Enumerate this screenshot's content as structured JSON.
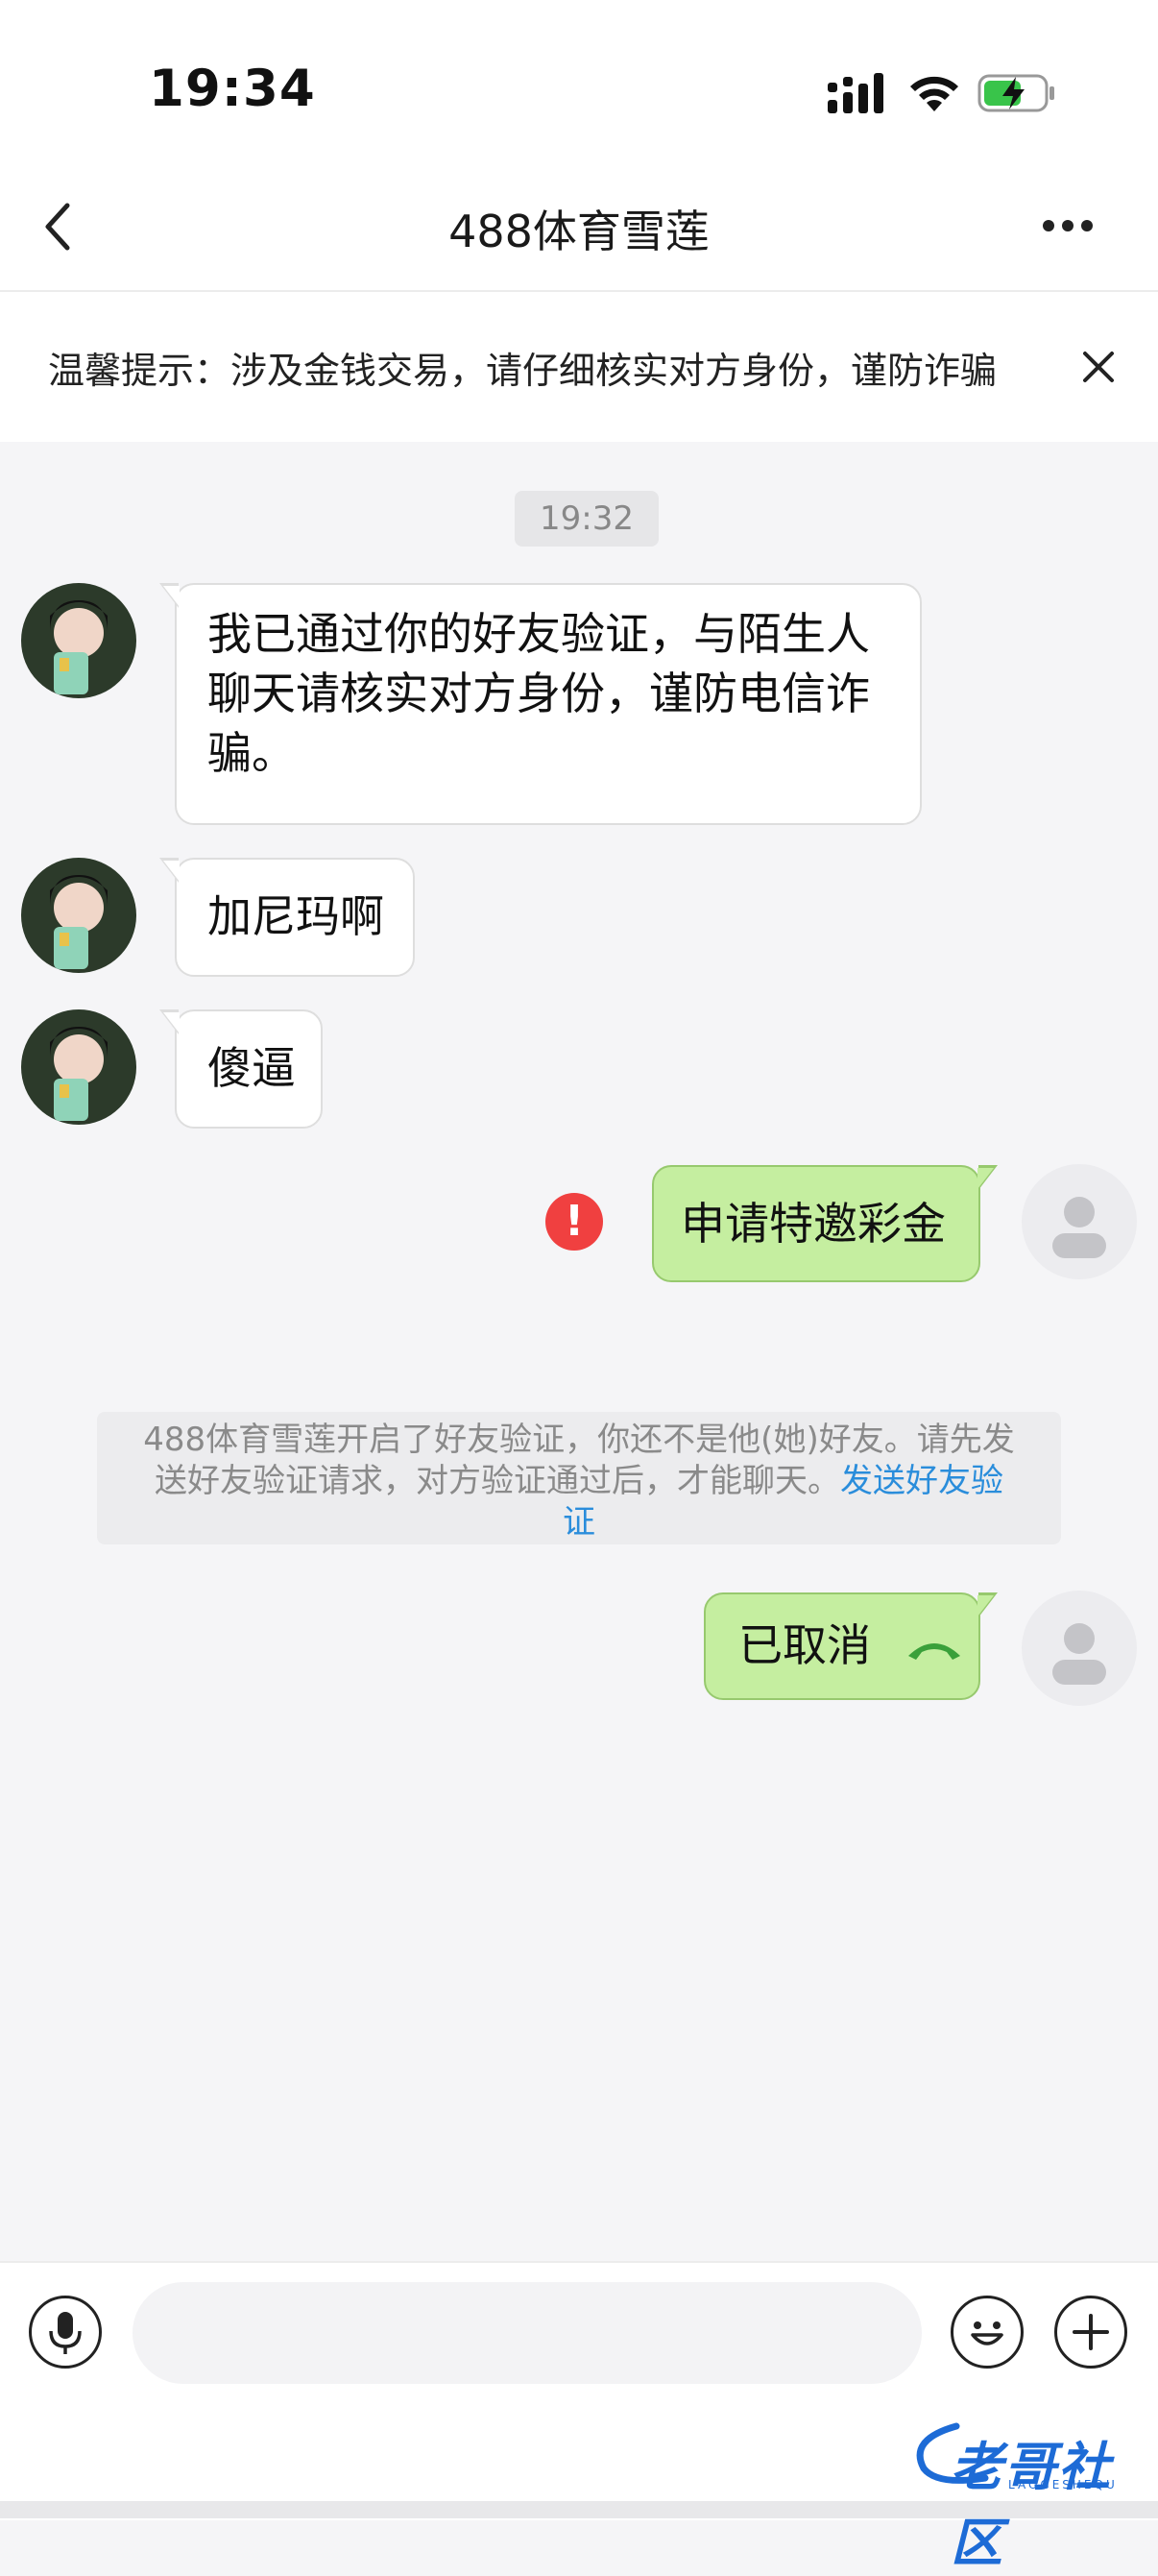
{
  "status_bar": {
    "time": "19:34"
  },
  "header": {
    "title": "488体育雪莲"
  },
  "banner": {
    "text": "温馨提示：涉及金钱交易，请仔细核实对方身份，谨防诈骗"
  },
  "chat": {
    "timestamp": "19:32",
    "messages": [
      {
        "from": "other",
        "lines": [
          "我已通过你的好友验证，与陌生人",
          "聊天请核实对方身份，谨防电信诈",
          "骗。"
        ]
      },
      {
        "from": "other",
        "text": "加尼玛啊"
      },
      {
        "from": "other",
        "text": "傻逼"
      },
      {
        "from": "me",
        "text": "申请特邀彩金",
        "status": "failed"
      },
      {
        "from": "me",
        "text": "已取消",
        "icon": "hangup-phone-icon"
      }
    ],
    "system_note": {
      "line1": "488体育雪莲开启了好友验证，你还不是他(她)好友。请先发",
      "line2_prefix": "送好友验证请求，对方验证通过后，才能聊天。",
      "link_part1": "发送好友验",
      "link_part2": "证"
    },
    "error_mark": "!"
  },
  "input_bar": {
    "placeholder": ""
  },
  "watermark": {
    "text": "老哥社区",
    "sub": "LAOGESHEQU"
  },
  "colors": {
    "mine_bubble": "#c5eea0",
    "link": "#2a8ddb",
    "error": "#f04040"
  }
}
